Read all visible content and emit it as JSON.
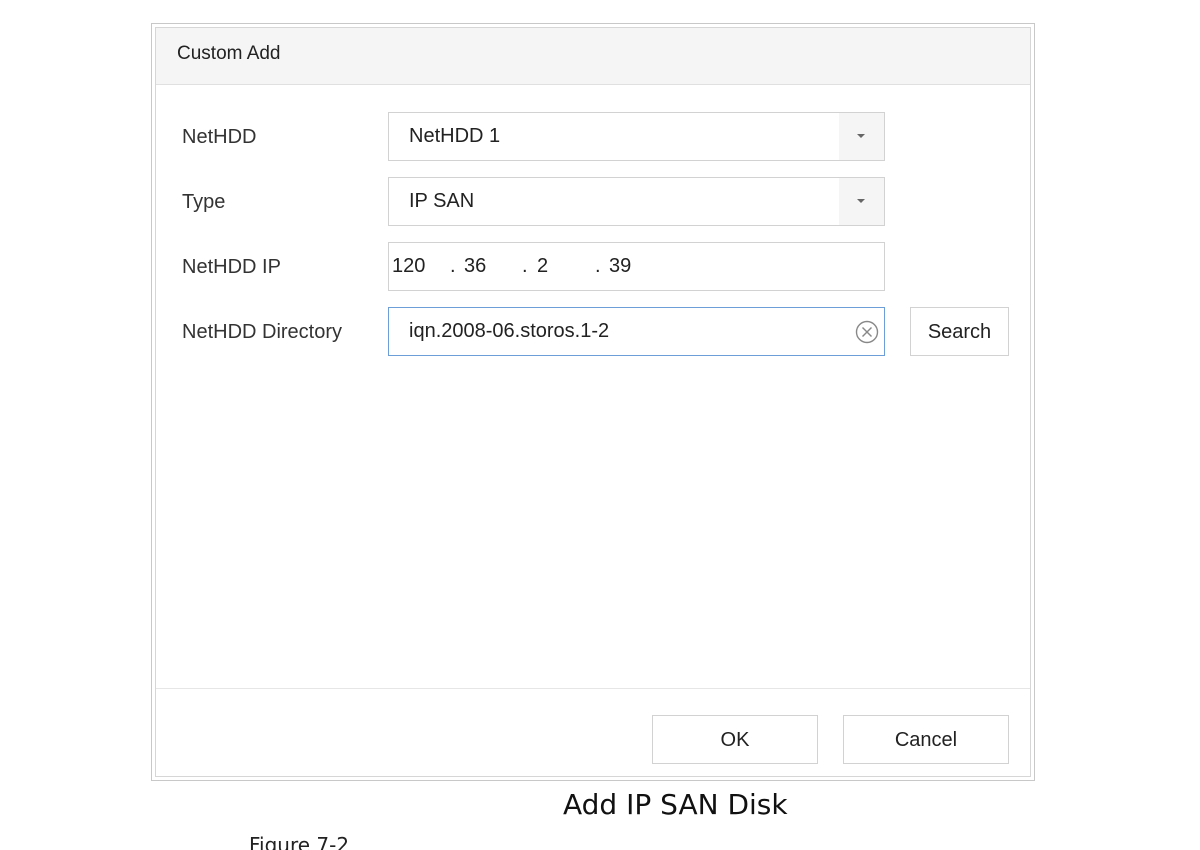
{
  "dialog": {
    "title": "Custom Add"
  },
  "form": {
    "nethdd": {
      "label": "NetHDD",
      "value": "NetHDD 1"
    },
    "type": {
      "label": "Type",
      "value": "IP SAN"
    },
    "nethdd_ip": {
      "label": "NetHDD IP",
      "segments": [
        "120",
        "36",
        "2",
        "39"
      ],
      "separator": "."
    },
    "nethdd_directory": {
      "label": "NetHDD Directory",
      "value": "iqn.2008-06.storos.1-2"
    },
    "search_label": "Search"
  },
  "footer": {
    "ok_label": "OK",
    "cancel_label": "Cancel"
  },
  "caption": {
    "text": "Add IP SAN Disk",
    "figure_label": "Figure 7-2"
  },
  "icons": {
    "dropdown": "chevron-down-icon",
    "clear": "clear-circle-icon"
  },
  "colors": {
    "header_bg": "#f5f5f5",
    "active_border": "#6d9ed8"
  }
}
